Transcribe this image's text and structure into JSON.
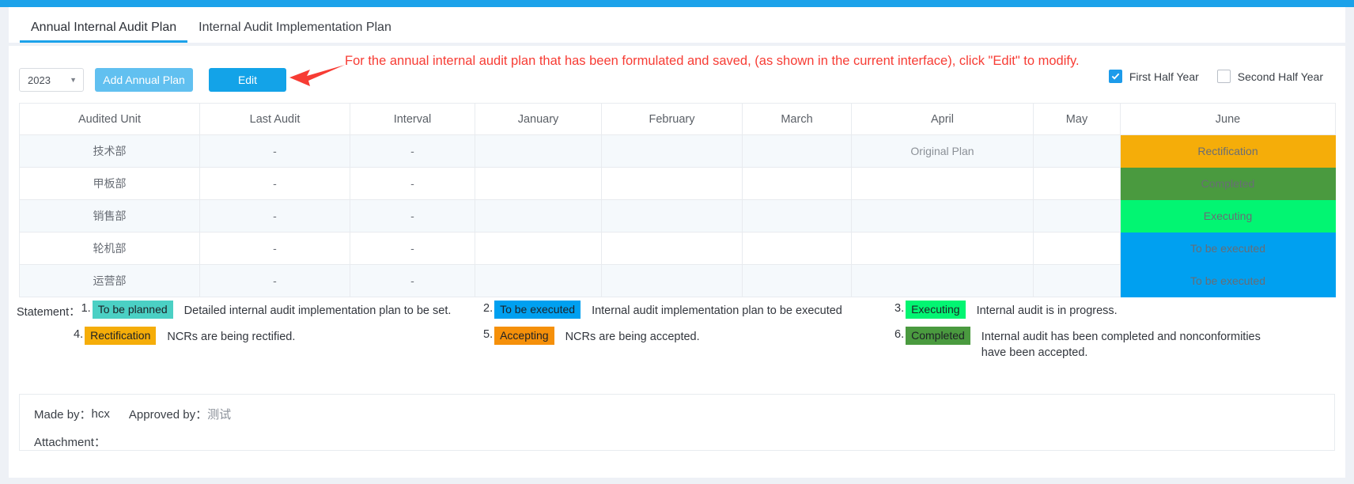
{
  "window": {
    "accent": "#1ca2ea"
  },
  "tabs": [
    {
      "label": "Annual Internal Audit Plan",
      "active": true
    },
    {
      "label": "Internal Audit Implementation Plan",
      "active": false
    }
  ],
  "toolbar": {
    "year_value": "2023",
    "caret_glyph": "▼",
    "add_label": "Add Annual Plan",
    "edit_label": "Edit"
  },
  "annotation": {
    "text": "For the annual internal audit plan that has been formulated and saved, (as shown in the current interface), click \"Edit\" to modify.",
    "color": "#f73c34"
  },
  "half_year": {
    "first_label": "First Half Year",
    "first_checked": true,
    "second_label": "Second Half Year",
    "second_checked": false
  },
  "table": {
    "columns": [
      "Audited Unit",
      "Last Audit",
      "Interval",
      "January",
      "February",
      "March",
      "April",
      "May",
      "June"
    ],
    "rows": [
      {
        "unit": "技术部",
        "last_audit": "-",
        "interval": "-",
        "january": "",
        "february": "",
        "march": "",
        "april": "Original Plan",
        "may": "",
        "june": "Rectification",
        "june_color": "#f5ad09"
      },
      {
        "unit": "甲板部",
        "last_audit": "-",
        "interval": "-",
        "january": "",
        "february": "",
        "march": "",
        "april": "",
        "may": "",
        "june": "Completed",
        "june_color": "#4a9a3f"
      },
      {
        "unit": "销售部",
        "last_audit": "-",
        "interval": "-",
        "january": "",
        "february": "",
        "march": "",
        "april": "",
        "may": "",
        "june": "Executing",
        "june_color": "#02f572"
      },
      {
        "unit": "轮机部",
        "last_audit": "-",
        "interval": "-",
        "january": "",
        "february": "",
        "march": "",
        "april": "",
        "may": "",
        "june": "To be executed",
        "june_color": "#00a0f0"
      },
      {
        "unit": "运营部",
        "last_audit": "-",
        "interval": "-",
        "january": "",
        "february": "",
        "march": "",
        "april": "",
        "may": "",
        "june": "To be executed",
        "june_color": "#00a0f0"
      }
    ]
  },
  "legend": {
    "title": "Statement：",
    "items": [
      {
        "num": "1.",
        "chip": "To be planned",
        "chip_color": "#4bd0c4",
        "desc": "Detailed internal audit implementation plan to be set."
      },
      {
        "num": "2.",
        "chip": "To be executed",
        "chip_color": "#00a0f0",
        "desc": "Internal audit implementation plan to be executed"
      },
      {
        "num": "3.",
        "chip": "Executing",
        "chip_color": "#02f572",
        "desc": "Internal audit is in progress."
      },
      {
        "num": "4.",
        "chip": "Rectification",
        "chip_color": "#f5ad09",
        "desc": "NCRs are being rectified."
      },
      {
        "num": "5.",
        "chip": "Accepting",
        "chip_color": "#f5900a",
        "desc": "NCRs are being accepted."
      },
      {
        "num": "6.",
        "chip": "Completed",
        "chip_color": "#4a9a3f",
        "desc": "Internal audit has been completed and nonconformities have been accepted."
      }
    ]
  },
  "footer": {
    "made_by_label": "Made by：",
    "made_by_value": "hcx",
    "approved_by_label": "Approved by：",
    "approved_by_value": "测试",
    "attachment_label": "Attachment：",
    "attachment_value": ""
  }
}
